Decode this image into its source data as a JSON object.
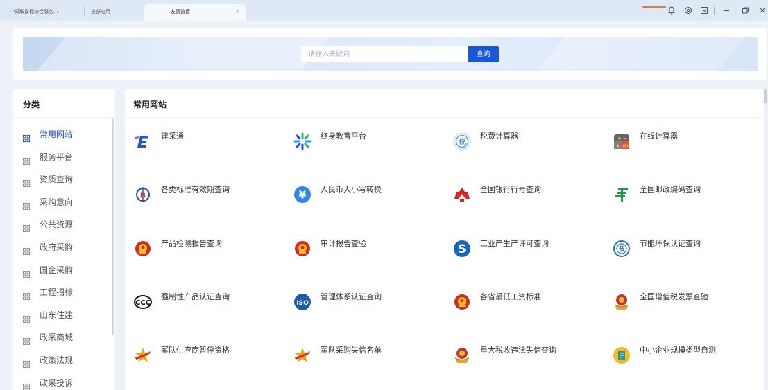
{
  "tabs": [
    {
      "label": "中易联投标综合服务..."
    },
    {
      "label": "全部应用"
    },
    {
      "label": "友情链接",
      "close": "×"
    }
  ],
  "window_controls": [
    "bell-icon",
    "settings-icon",
    "screenshot-icon",
    "minimize-icon",
    "restore-icon",
    "close-icon"
  ],
  "search": {
    "placeholder": "请输入关键词",
    "value": "",
    "button": "查询"
  },
  "sidebar": {
    "title": "分类",
    "items": [
      {
        "label": "常用网站",
        "active": true
      },
      {
        "label": "服务平台"
      },
      {
        "label": "资质查询"
      },
      {
        "label": "采购意向"
      },
      {
        "label": "公共资源"
      },
      {
        "label": "政府采购"
      },
      {
        "label": "国企采购"
      },
      {
        "label": "工程招标"
      },
      {
        "label": "山东住建"
      },
      {
        "label": "政采商城"
      },
      {
        "label": "政策法规"
      },
      {
        "label": "政采投诉"
      }
    ]
  },
  "main": {
    "title": "常用网站",
    "links": [
      {
        "label": "建采通",
        "icon": "jiancaitong-logo-icon"
      },
      {
        "label": "终身教育平台",
        "icon": "education-logo-icon"
      },
      {
        "label": "税费计算器",
        "icon": "tax-calculator-icon"
      },
      {
        "label": "在线计算器",
        "icon": "calculator-icon"
      },
      {
        "label": "各类标准有效期查询",
        "icon": "standard-logo-icon"
      },
      {
        "label": "人民币大小写转换",
        "icon": "yuan-icon"
      },
      {
        "label": "全国银行行号查询",
        "icon": "bank-logo-icon"
      },
      {
        "label": "全国邮政编码查询",
        "icon": "postal-logo-icon"
      },
      {
        "label": "产品检测报告查询",
        "icon": "national-emblem-icon"
      },
      {
        "label": "审计报告查验",
        "icon": "national-emblem-icon"
      },
      {
        "label": "工业产生产许可查询",
        "icon": "qs-logo-icon"
      },
      {
        "label": "节能环保认证查询",
        "icon": "energy-saving-icon"
      },
      {
        "label": "强制性产品认证查询",
        "icon": "ccc-logo-icon"
      },
      {
        "label": "管理体系认证查询",
        "icon": "iso-logo-icon"
      },
      {
        "label": "各省最低工资标准",
        "icon": "national-emblem-icon"
      },
      {
        "label": "全国增值税发票查验",
        "icon": "tax-emblem-icon"
      },
      {
        "label": "军队供应商暂停资格",
        "icon": "military-star-icon"
      },
      {
        "label": "军队采购失信名单",
        "icon": "military-star-icon"
      },
      {
        "label": "重大税收违法失信查询",
        "icon": "tax-emblem-icon"
      },
      {
        "label": "中小企业规模类型自测",
        "icon": "enterprise-test-icon"
      }
    ]
  },
  "colors": {
    "accent": "#1a56d8",
    "background": "#eef2f8",
    "highlight": "#f07a1c"
  }
}
